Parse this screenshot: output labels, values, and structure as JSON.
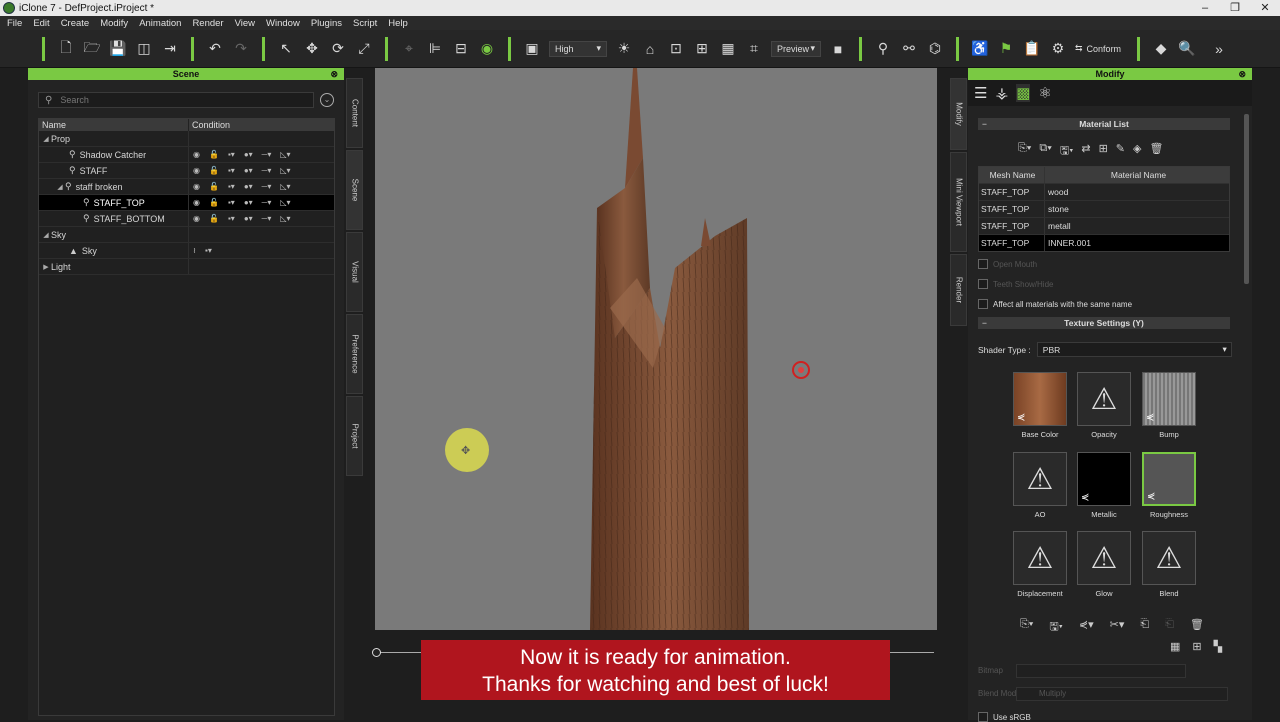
{
  "window": {
    "title": "iClone 7 - DefProject.iProject *",
    "controls": [
      "–",
      "❐",
      "✕"
    ]
  },
  "menu": [
    "File",
    "Edit",
    "Create",
    "Modify",
    "Animation",
    "Render",
    "View",
    "Window",
    "Plugins",
    "Script",
    "Help"
  ],
  "toolbar": {
    "quality": "High",
    "preview": "Preview",
    "conform": "Conform"
  },
  "scene": {
    "header": "Scene",
    "search_placeholder": "Search",
    "columns": {
      "name": "Name",
      "condition": "Condition"
    },
    "rows": [
      {
        "label": "Prop",
        "level": 0,
        "arrow": "◢"
      },
      {
        "label": "Shadow Catcher",
        "level": 2
      },
      {
        "label": "STAFF",
        "level": 2
      },
      {
        "label": "staff broken",
        "level": 1,
        "arrow": "◢"
      },
      {
        "label": "STAFF_TOP",
        "level": 3,
        "selected": true
      },
      {
        "label": "STAFF_BOTTOM",
        "level": 3
      },
      {
        "label": "Sky",
        "level": 0,
        "arrow": "◢"
      },
      {
        "label": "Sky",
        "level": 2
      },
      {
        "label": "Light",
        "level": 0,
        "arrow": "▶"
      }
    ]
  },
  "left_tabs": [
    "Content",
    "Scene",
    "Visual",
    "Preference",
    "Project"
  ],
  "right_tabs": [
    "Modify",
    "Mini Viewport",
    "Render"
  ],
  "subtitle": {
    "line1": "Now it is ready for animation.",
    "line2": "Thanks for watching and best of luck!"
  },
  "modify": {
    "header": "Modify",
    "material_list": "Material List",
    "table_headers": {
      "mesh": "Mesh Name",
      "material": "Material Name"
    },
    "materials": [
      {
        "mesh": "STAFF_TOP",
        "material": "wood"
      },
      {
        "mesh": "STAFF_TOP",
        "material": "stone"
      },
      {
        "mesh": "STAFF_TOP",
        "material": "metall"
      },
      {
        "mesh": "STAFF_TOP",
        "material": "INNER.001",
        "selected": true
      }
    ],
    "open_mouth": "Open Mouth",
    "teeth": "Teeth Show/Hide",
    "affect_all": "Affect all materials with the same name",
    "texture_settings": "Texture Settings  (Y)",
    "shader_label": "Shader Type :",
    "shader_value": "PBR",
    "textures": [
      "Base Color",
      "Opacity",
      "Bump",
      "AO",
      "Metallic",
      "Roughness",
      "Displacement",
      "Glow",
      "Blend"
    ],
    "bitmap_label": "Bitmap",
    "blend_mode_label": "Blend Mode",
    "blend_mode_value": "Multiply",
    "use_srgb": "Use sRGB"
  },
  "colors": {
    "accent": "#7ac943",
    "subtitle_bg": "#b0151e",
    "viewport_bg": "#7a7a7a"
  }
}
